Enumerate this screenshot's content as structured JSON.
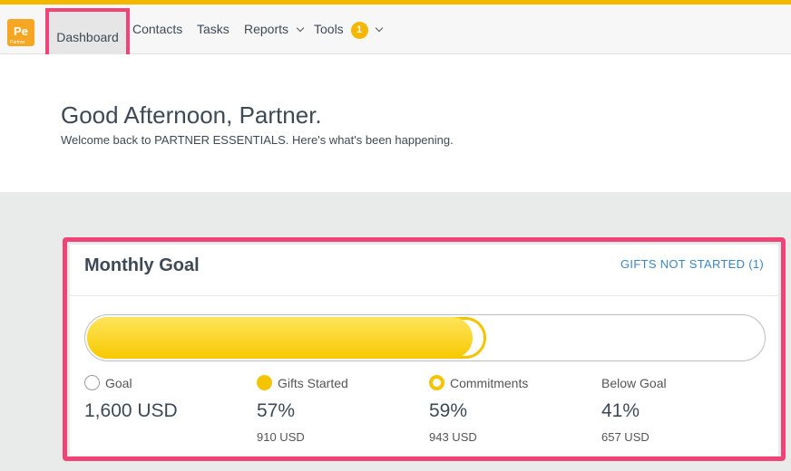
{
  "app": {
    "logo_text": "Pe",
    "logo_sub": "Partner"
  },
  "nav": {
    "dashboard": "Dashboard",
    "contacts": "Contacts",
    "tasks": "Tasks",
    "reports": "Reports",
    "tools": "Tools",
    "tools_badge": "1"
  },
  "hero": {
    "greeting": "Good Afternoon, Partner.",
    "subtitle": "Welcome back to PARTNER ESSENTIALS. Here's what's been happening."
  },
  "monthly_goal": {
    "title": "Monthly Goal",
    "gifts_link": "GIFTS NOT STARTED (1)",
    "progress": {
      "gifts_started_fraction": 0.57,
      "commitments_fraction": 0.59
    },
    "colors": {
      "accent": "#f5c400",
      "highlight": "#f04478",
      "link": "#3a87c8"
    },
    "stats": [
      {
        "label": "Goal",
        "value": "1,600 USD",
        "amount": ""
      },
      {
        "label": "Gifts Started",
        "value": "57%",
        "amount": "910 USD"
      },
      {
        "label": "Commitments",
        "value": "59%",
        "amount": "943 USD"
      },
      {
        "label": "Below Goal",
        "value": "41%",
        "amount": "657 USD"
      }
    ]
  }
}
